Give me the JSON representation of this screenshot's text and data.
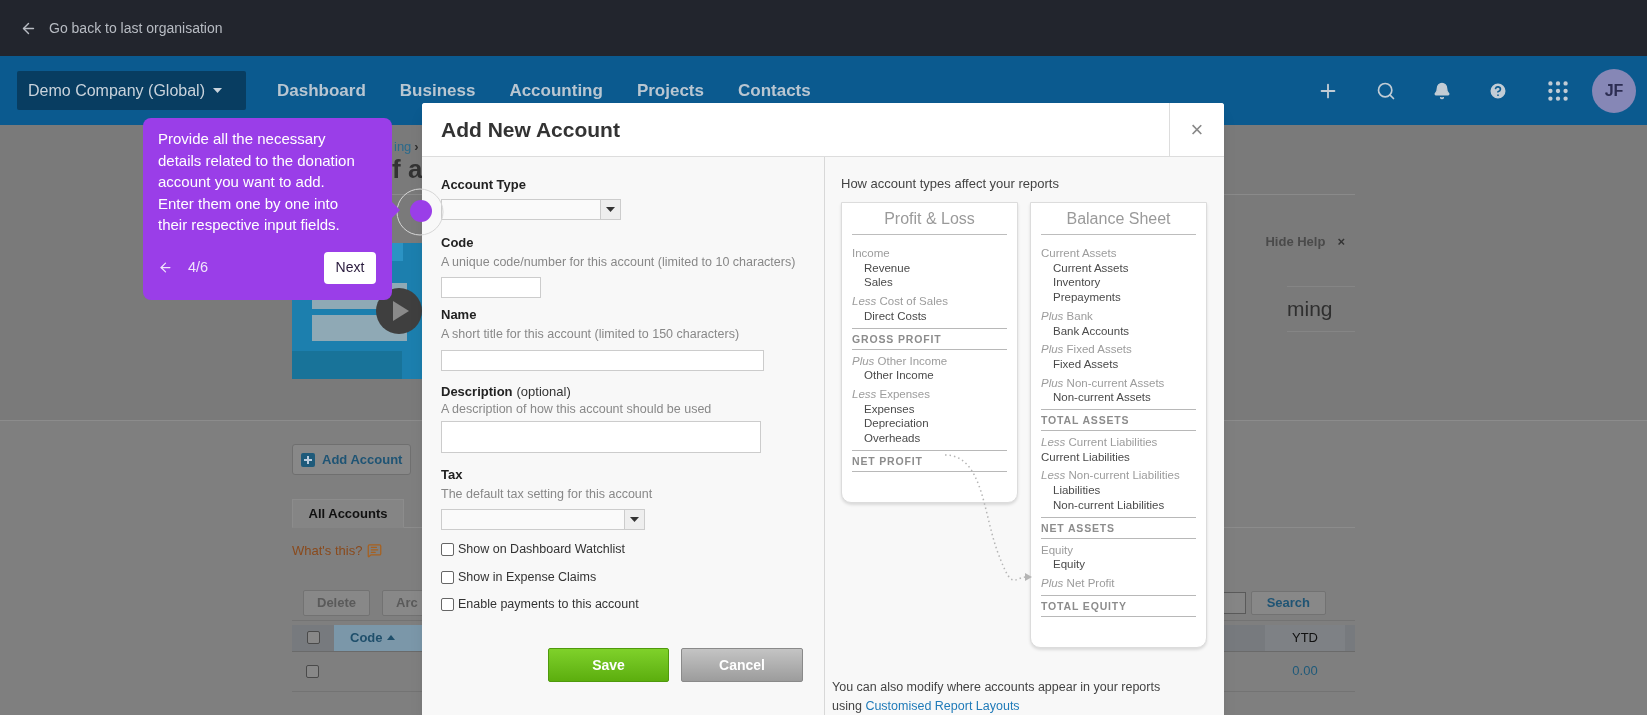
{
  "topbar": {
    "back_link": "Go back to last organisation"
  },
  "nav": {
    "organisation": "Demo Company (Global)",
    "items": [
      "Dashboard",
      "Business",
      "Accounting",
      "Projects",
      "Contacts"
    ],
    "avatar": "JF"
  },
  "page": {
    "breadcrumb": "ing",
    "breadcrumb_separator": "›",
    "title": "f a",
    "hide_help": "Hide Help",
    "hide_help_close": "×",
    "help_title": "ming",
    "add_button": "Add Account",
    "tabs": [
      {
        "label": "All Accounts",
        "selected": true
      }
    ],
    "whats_this": "What's this?",
    "toolbar_buttons": [
      "Delete",
      "Arc"
    ],
    "search_button": "Search",
    "table": {
      "header_checked": false,
      "columns": [
        {
          "label": "Code",
          "sorted": true
        },
        {
          "label": "YTD",
          "sorted": false
        }
      ],
      "rows": [
        {
          "checked": false,
          "ytd": "0.00"
        }
      ]
    }
  },
  "modal": {
    "title": "Add New Account",
    "close": "×",
    "fields": [
      {
        "kind": "select",
        "label": "Account Type"
      },
      {
        "kind": "input",
        "label": "Code",
        "help": "A unique code/number for this account (limited to 10 characters)"
      },
      {
        "kind": "input_wide",
        "label": "Name",
        "help": "A short title for this account (limited to 150 characters)"
      },
      {
        "kind": "textarea",
        "label": "Description",
        "label_note": "(optional)",
        "help": "A description of how this account should be used"
      },
      {
        "kind": "select_wide",
        "label": "Tax",
        "help": "The default tax setting for this account"
      }
    ],
    "checkboxes": [
      {
        "label": "Show on Dashboard Watchlist",
        "checked": false
      },
      {
        "label": "Show in Expense Claims",
        "checked": false
      },
      {
        "label": "Enable payments to this account",
        "checked": false
      }
    ],
    "save": "Save",
    "cancel": "Cancel",
    "help_panel": {
      "heading": "How account types affect your reports",
      "reports": [
        {
          "title": "Profit & Loss",
          "items": [
            {
              "kind": "group",
              "text": "Income"
            },
            {
              "kind": "account",
              "text": "Revenue"
            },
            {
              "kind": "account",
              "text": "Sales"
            },
            {
              "kind": "group",
              "text": "*Less* Cost of Sales"
            },
            {
              "kind": "account",
              "text": "Direct Costs"
            },
            {
              "kind": "total",
              "text": "GROSS PROFIT"
            },
            {
              "kind": "group",
              "text": "*Plus* Other Income"
            },
            {
              "kind": "account",
              "text": "Other Income"
            },
            {
              "kind": "group",
              "text": "*Less* Expenses"
            },
            {
              "kind": "account",
              "text": "Expenses"
            },
            {
              "kind": "account",
              "text": "Depreciation"
            },
            {
              "kind": "account",
              "text": "Overheads"
            },
            {
              "kind": "total",
              "text": "NET PROFIT"
            }
          ]
        },
        {
          "title": "Balance Sheet",
          "items": [
            {
              "kind": "group",
              "text": "Current Assets"
            },
            {
              "kind": "account",
              "text": "Current Assets"
            },
            {
              "kind": "account",
              "text": "Inventory"
            },
            {
              "kind": "account",
              "text": "Prepayments"
            },
            {
              "kind": "group",
              "text": "*Plus* Bank"
            },
            {
              "kind": "account",
              "text": "Bank Accounts"
            },
            {
              "kind": "group",
              "text": "*Plus* Fixed Assets"
            },
            {
              "kind": "account",
              "text": "Fixed Assets"
            },
            {
              "kind": "group",
              "text": "*Plus* Non-current Assets"
            },
            {
              "kind": "account",
              "text": "Non-current Assets"
            },
            {
              "kind": "total",
              "text": "TOTAL ASSETS"
            },
            {
              "kind": "group",
              "text": "*Less* Current Liabilities"
            },
            {
              "kind": "account_flush",
              "text": "Current Liabilities"
            },
            {
              "kind": "group",
              "text": "*Less* Non-current Liabilities"
            },
            {
              "kind": "account",
              "text": "Liabilities"
            },
            {
              "kind": "account",
              "text": "Non-current Liabilities"
            },
            {
              "kind": "total",
              "text": "NET ASSETS"
            },
            {
              "kind": "group",
              "text": "Equity"
            },
            {
              "kind": "account",
              "text": "Equity"
            },
            {
              "kind": "group",
              "text": "*Plus* Net Profit"
            },
            {
              "kind": "total",
              "text": "TOTAL EQUITY"
            }
          ]
        }
      ],
      "footer_text": "You can also modify where accounts appear in your reports using",
      "footer_link": "Customised Report Layouts"
    }
  },
  "tour": {
    "text": "Provide all the necessary details related to the donation account you want to add. Enter them one by one into their respective input fields.",
    "counter": "4/6",
    "next": "Next"
  }
}
